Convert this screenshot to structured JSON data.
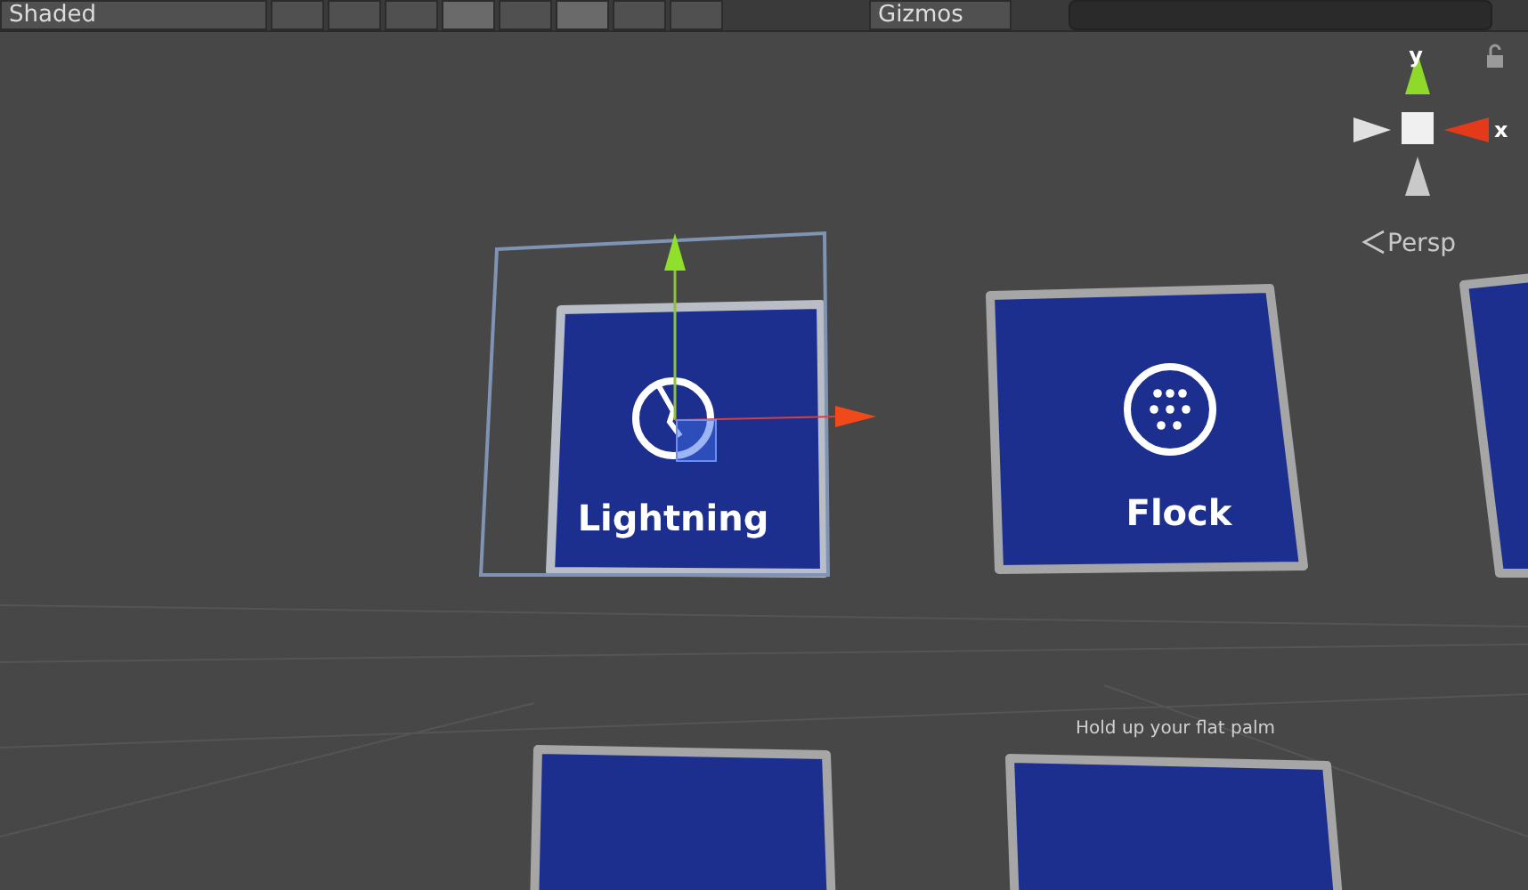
{
  "toolbar": {
    "shading_mode": "Shaded",
    "toggles": [
      {
        "on": false
      },
      {
        "on": false
      },
      {
        "on": false
      },
      {
        "on": true
      },
      {
        "on": false
      },
      {
        "on": true
      },
      {
        "on": false
      },
      {
        "on": false
      }
    ],
    "gizmos": "Gizmos"
  },
  "orientation_gizmo": {
    "y_label": "y",
    "x_label": "x",
    "projection": "Persp"
  },
  "tiles": [
    {
      "label": "Lightning",
      "kind": "lightning",
      "selected": true
    },
    {
      "label": "Flock",
      "kind": "flock",
      "selected": false
    },
    {
      "kind": "plain",
      "selected": false
    },
    {
      "kind": "plain",
      "selected": false
    },
    {
      "kind": "plain",
      "selected": false
    }
  ],
  "hint": "Hold up your flat palm"
}
